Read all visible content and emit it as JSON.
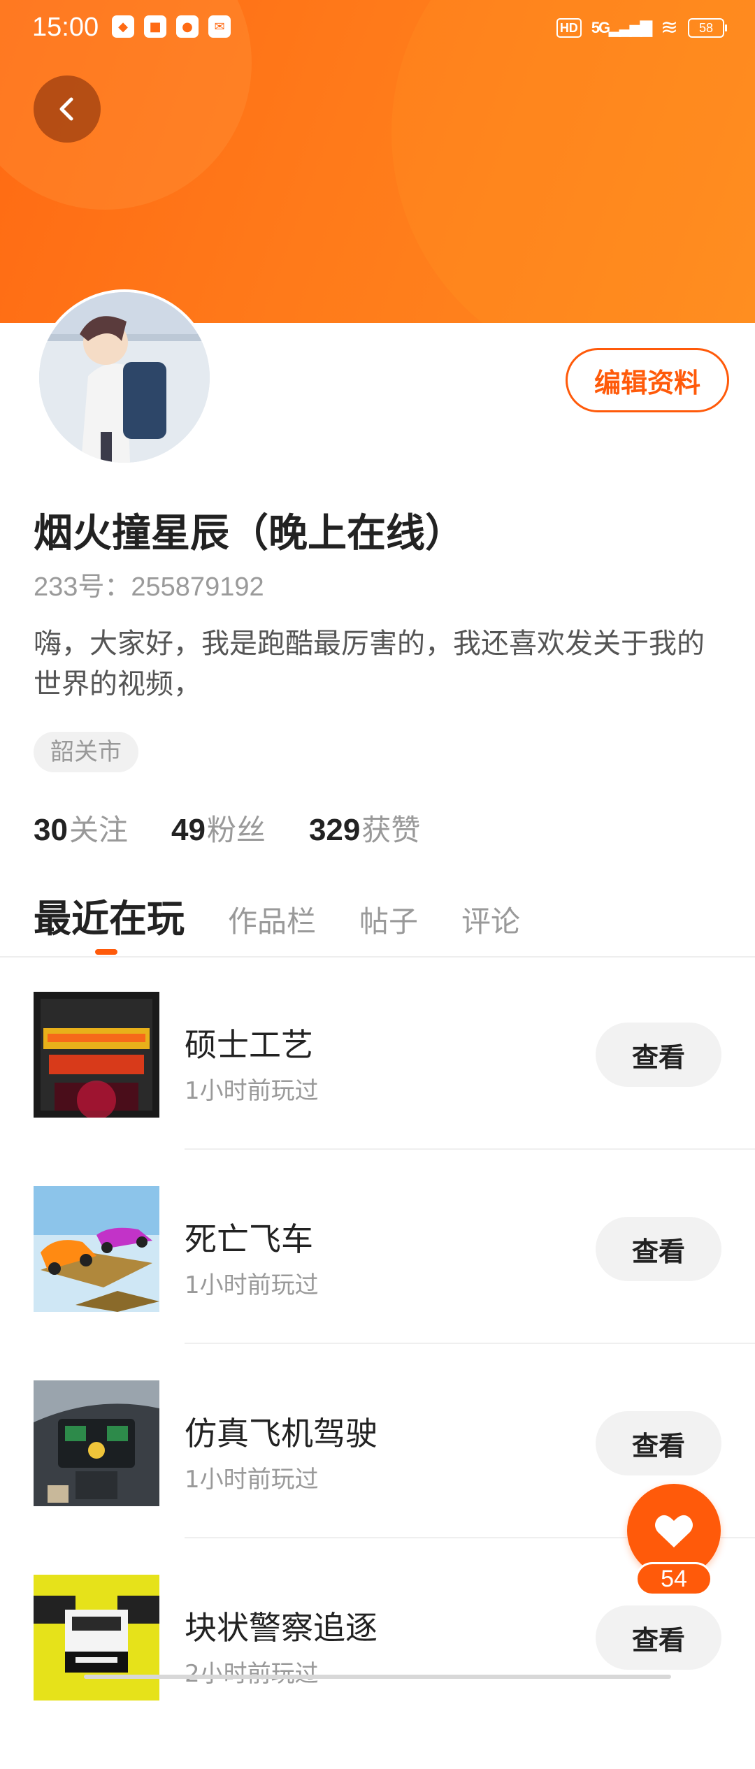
{
  "status_bar": {
    "time": "15:00",
    "notification_icons": [
      "app-notification-icon",
      "app-notification-icon",
      "app-notification-icon",
      "app-notification-icon"
    ],
    "hd": "HD",
    "network": "5G",
    "battery": "58"
  },
  "profile": {
    "edit_label": "编辑资料",
    "name": "烟火撞星辰（晚上在线）",
    "id_line": "233号：255879192",
    "bio": "嗨，大家好，我是跑酷最厉害的，我还喜欢发关于我的世界的视频，",
    "location": "韶关市"
  },
  "stats": [
    {
      "count": "30",
      "label": "关注"
    },
    {
      "count": "49",
      "label": "粉丝"
    },
    {
      "count": "329",
      "label": "获赞"
    }
  ],
  "tabs": [
    {
      "label": "最近在玩",
      "active": true
    },
    {
      "label": "作品栏"
    },
    {
      "label": "帖子"
    },
    {
      "label": "评论"
    }
  ],
  "games": [
    {
      "title": "硕士工艺",
      "time": "1小时前玩过",
      "action": "查看",
      "icon": "mastercraft-game-icon"
    },
    {
      "title": "死亡飞车",
      "time": "1小时前玩过",
      "action": "查看",
      "icon": "death-racing-game-icon"
    },
    {
      "title": "仿真飞机驾驶",
      "time": "1小时前玩过",
      "action": "查看",
      "icon": "flight-simulator-game-icon"
    },
    {
      "title": "块状警察追逐",
      "time": "2小时前玩过",
      "action": "查看",
      "icon": "blocky-police-chase-game-icon"
    }
  ],
  "like_fab": {
    "count": "54"
  },
  "colors": {
    "accent": "#ff5a0a",
    "header_start": "#ff6a13",
    "header_end": "#ff8a1f"
  }
}
